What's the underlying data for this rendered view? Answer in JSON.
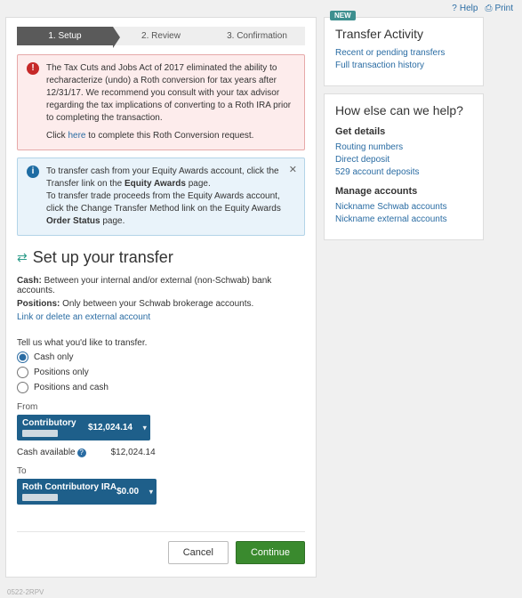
{
  "topbar": {
    "help": "Help",
    "print": "Print"
  },
  "steps": [
    {
      "n": "1.",
      "label": "Setup"
    },
    {
      "n": "2.",
      "label": "Review"
    },
    {
      "n": "3.",
      "label": "Confirmation"
    }
  ],
  "alert_error": {
    "body": "The Tax Cuts and Jobs Act of 2017 eliminated the ability to recharacterize (undo) a Roth conversion for tax years after 12/31/17. We recommend you consult with your tax advisor regarding the tax implications of converting to a Roth IRA prior to completing the transaction.",
    "click": "Click ",
    "here": "here",
    "tail": " to complete this Roth Conversion request."
  },
  "alert_info": {
    "l1a": "To transfer cash from your Equity Awards account, click the Transfer link on the ",
    "l1b": "Equity Awards",
    "l1c": " page.",
    "l2a": "To transfer trade proceeds from the Equity Awards account, click the Change Transfer Method link on the Equity Awards ",
    "l2b": "Order Status",
    "l2c": " page."
  },
  "title": "Set up your transfer",
  "desc_cash_label": "Cash:",
  "desc_cash_text": " Between your internal and/or external (non-Schwab) bank accounts.",
  "desc_pos_label": "Positions:",
  "desc_pos_text": " Only between your Schwab brokerage accounts.",
  "link_external": "Link or delete an external account",
  "prompt": "Tell us what you'd like to transfer.",
  "opts": {
    "cash": "Cash only",
    "positions": "Positions only",
    "both": "Positions and cash"
  },
  "from_label": "From",
  "to_label": "To",
  "from_acct": {
    "name": "Contributory",
    "amount": "$12,024.14"
  },
  "to_acct": {
    "name": "Roth Contributory IRA",
    "amount": "$0.00"
  },
  "cash_avail_label": "Cash available",
  "cash_avail_amt": "$12,024.14",
  "btn_cancel": "Cancel",
  "btn_continue": "Continue",
  "side_activity": {
    "badge": "NEW",
    "title": "Transfer Activity",
    "links": [
      "Recent or pending transfers",
      "Full transaction history"
    ]
  },
  "side_help": {
    "title": "How else can we help?",
    "sec1": "Get details",
    "links1": [
      "Routing numbers",
      "Direct deposit",
      "529 account deposits"
    ],
    "sec2": "Manage accounts",
    "links2": [
      "Nickname Schwab accounts",
      "Nickname external accounts"
    ]
  },
  "footer_code": "0522-2RPV"
}
